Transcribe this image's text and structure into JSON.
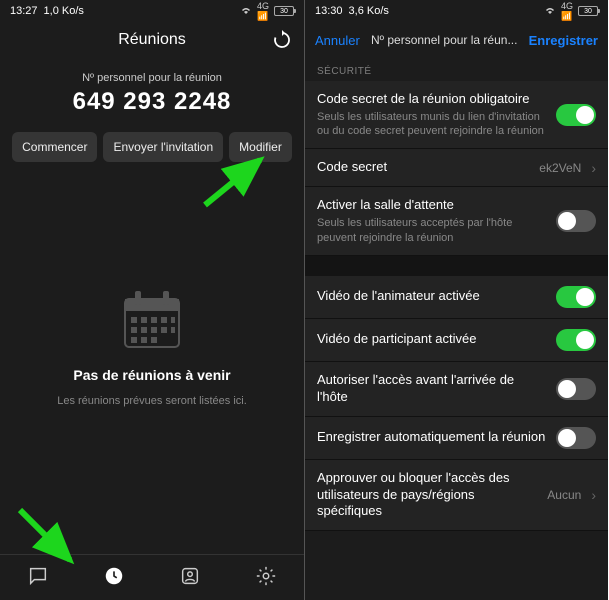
{
  "left": {
    "status": {
      "time": "13:27",
      "net": "1,0 Ko/s",
      "batt": "30"
    },
    "title": "Réunions",
    "sub": "Nº personnel pour la réunion",
    "pmi": "649 293 2248",
    "btn_start": "Commencer",
    "btn_invite": "Envoyer l'invitation",
    "btn_edit": "Modifier",
    "empty_title": "Pas de réunions à venir",
    "empty_sub": "Les réunions prévues seront listées ici."
  },
  "right": {
    "status": {
      "time": "13:30",
      "net": "3,6 Ko/s",
      "batt": "30"
    },
    "cancel": "Annuler",
    "title": "Nº personnel pour la réun...",
    "save": "Enregistrer",
    "sec_header": "SÉCURITÉ",
    "rows": {
      "passcode_req": {
        "lbl": "Code secret de la réunion obligatoire",
        "desc": "Seuls les utilisateurs munis du lien d'invitation ou du code secret peuvent rejoindre la réunion",
        "on": true
      },
      "passcode": {
        "lbl": "Code secret",
        "val": "ek2VeN"
      },
      "waiting": {
        "lbl": "Activer la salle d'attente",
        "desc": "Seuls les utilisateurs acceptés par l'hôte peuvent rejoindre la réunion",
        "on": false
      },
      "hostvid": {
        "lbl": "Vidéo de l'animateur activée",
        "on": true
      },
      "partvid": {
        "lbl": "Vidéo de participant activée",
        "on": true
      },
      "joinbefore": {
        "lbl": "Autoriser l'accès avant l'arrivée de l'hôte",
        "on": false
      },
      "autorec": {
        "lbl": "Enregistrer automatiquement la réunion",
        "on": false
      },
      "approve": {
        "lbl": "Approuver ou bloquer l'accès des utilisateurs de pays/régions spécifiques",
        "val": "Aucun"
      }
    }
  }
}
